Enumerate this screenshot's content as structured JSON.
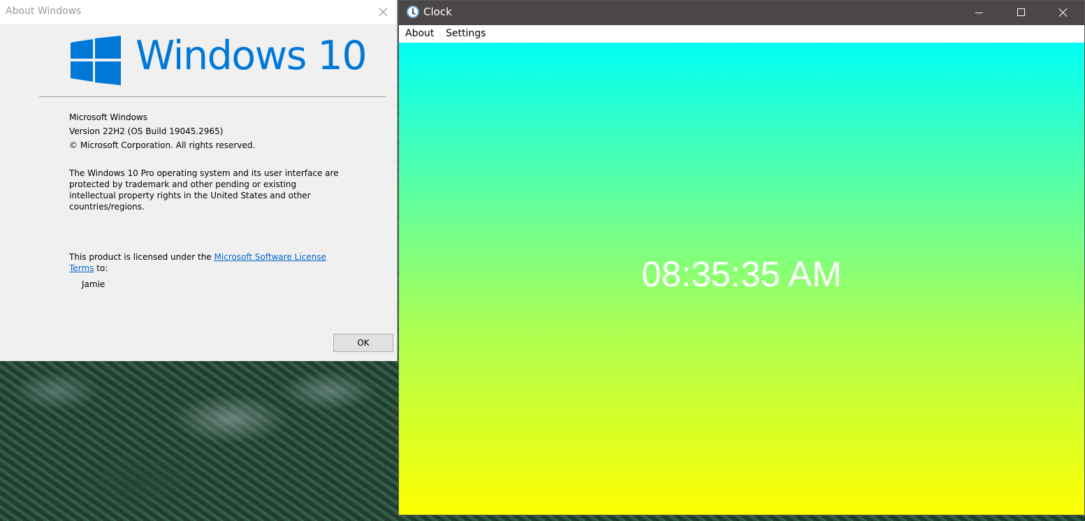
{
  "about_window": {
    "title": "About Windows",
    "logo_text": "Windows 10",
    "product_name": "Microsoft Windows",
    "version": "Version 22H2 (OS Build 19045.2965)",
    "copyright": "© Microsoft Corporation. All rights reserved.",
    "description": "The Windows 10 Pro operating system and its user interface are protected by trademark and other pending or existing intellectual property rights in the United States and other countries/regions.",
    "license_prefix": "This product is licensed under the ",
    "license_link": "Microsoft Software License Terms",
    "license_suffix": " to:",
    "licensee": "Jamie",
    "ok_label": "OK",
    "accent_color": "#0078d7"
  },
  "clock_window": {
    "title": "Clock",
    "menu": [
      {
        "label": "About"
      },
      {
        "label": "Settings"
      }
    ],
    "time": "08:35:35 AM",
    "gradient_colors": [
      "#00fff5",
      "#66ff99",
      "#a9ff55",
      "#ffff00"
    ]
  },
  "icons": {
    "about_close": "close-icon",
    "windows_logo": "windows-logo-icon",
    "clock_app": "clock-icon",
    "minimize": "minimize-icon",
    "maximize": "maximize-icon",
    "close": "close-icon"
  }
}
